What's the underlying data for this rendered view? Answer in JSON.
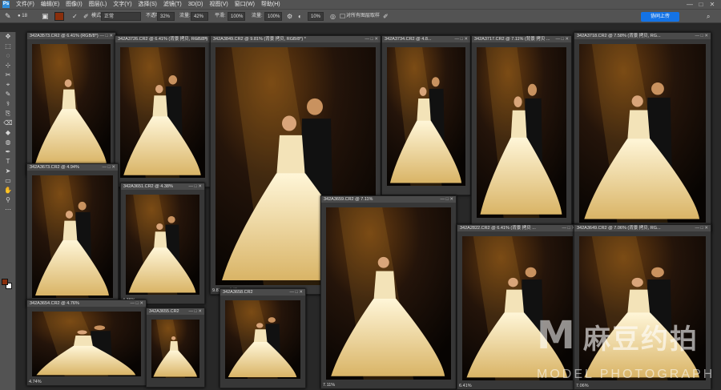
{
  "menubar": {
    "logo": "Ps",
    "items": [
      "文件(F)",
      "编辑(E)",
      "图像(I)",
      "图层(L)",
      "文字(Y)",
      "选择(S)",
      "滤镜(T)",
      "3D(D)",
      "视图(V)",
      "窗口(W)",
      "帮助(H)"
    ],
    "win": [
      "—",
      "□",
      "✕"
    ]
  },
  "options": {
    "brush_size": "18",
    "mode_label": "模式:",
    "mode": "正常",
    "opacity_label": "不透明度:",
    "opacity": "32%",
    "flow_label": "流量:",
    "flow": "42%",
    "smooth_label": "平滑:",
    "smooth": "100%",
    "smooth2_label": "流量:",
    "smooth2": "100%",
    "angle": "10%",
    "sample_label": "对所有图层取样",
    "upload": "协同上传"
  },
  "tools": [
    "✥",
    "⬚",
    "◌",
    "⊹",
    "✂",
    "⌖",
    "✎",
    "⚕",
    "⎘",
    "⌫",
    "◆",
    "◍",
    "✒",
    "T",
    "➤",
    "▭",
    "✋",
    "⚲",
    "⋯"
  ],
  "windows": [
    {
      "title": "342A3573.CR2 @ 6.41% (RGB/8*)",
      "status": "",
      "scene": "bride-alone"
    },
    {
      "title": "342A3726.CR2 @ 6.41% (背景 拷贝, RGB/8*)",
      "status": "",
      "scene": "couple-veil"
    },
    {
      "title": "342A3651.CR2 @ 4.38%",
      "status": "4.38%",
      "scene": "couple-seated"
    },
    {
      "title": "342A3673.CR2 @ 4.94%",
      "status": "4.94%",
      "scene": "couple-standing-veil"
    },
    {
      "title": "342A3849.CR2 @ 9.81% (背景 拷贝, RGB/8*) *",
      "status": "9.81%",
      "status2": "文档:80.3M/160.2M",
      "scene": "couple-main"
    },
    {
      "title": "342A3734.CR2 @ 4.8...",
      "status": "",
      "scene": "couple-veil-bright"
    },
    {
      "title": "342A3717.CR2 @ 7.11% (背景 拷贝 ...",
      "status": "",
      "scene": "couple-back"
    },
    {
      "title": "342A3718.CR2 @ 7.58% (背景 拷贝, RG...",
      "status": "",
      "scene": "couple-kiss"
    },
    {
      "title": "342A3654.CR2 @ 4.76%",
      "status": "4.74%",
      "scene": "couple-small"
    },
    {
      "title": "342A3655.CR2",
      "status": "",
      "scene": "bride-seated-small"
    },
    {
      "title": "342A3658.CR2",
      "status": "",
      "scene": "couple-standing-small"
    },
    {
      "title": "342A3659.CR2 @ 7.11%",
      "status": "7.11%",
      "scene": "bride-seated-wide"
    },
    {
      "title": "342A2822.CR2 @ 6.41% (背景 拷贝 ...",
      "status": "6.41%",
      "scene": "couple-light"
    },
    {
      "title": "342A3649.CR2 @ 7.06% (背景 拷贝, RG...",
      "status": "7.06%",
      "scene": "couple-closeup"
    }
  ],
  "watermark": {
    "m": "M",
    "cn": "麻豆约拍",
    "en": "MODEL PHOTOGRAPH"
  }
}
